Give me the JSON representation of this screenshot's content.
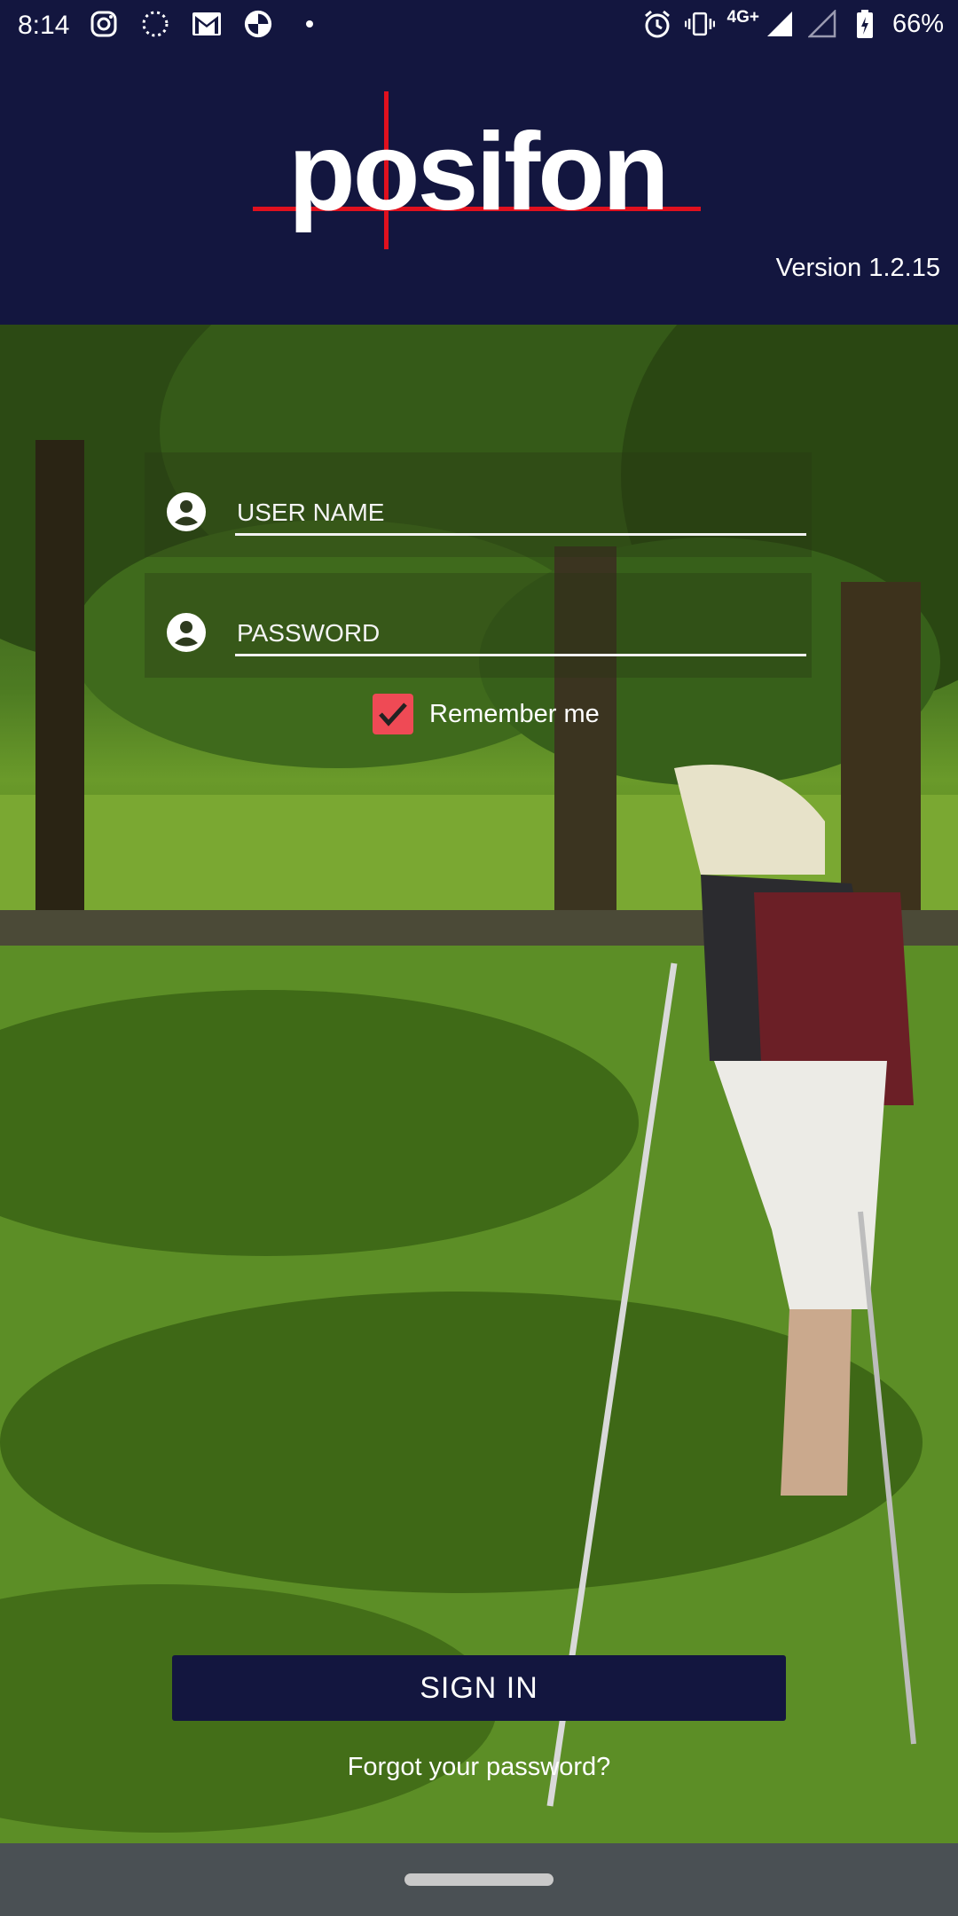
{
  "status_bar": {
    "time": "8:14",
    "network": "4G+",
    "battery": "66%",
    "left_icons": [
      "instagram-icon",
      "loading-dots-icon",
      "gmail-icon",
      "shutter-icon",
      "dot-icon"
    ],
    "right_icons": [
      "alarm-icon",
      "vibrate-icon",
      "signal-icon",
      "signal-empty-icon",
      "battery-charging-icon"
    ]
  },
  "header": {
    "logo_text": "posifon",
    "version": "Version 1.2.15"
  },
  "login": {
    "username_placeholder": "USER NAME",
    "password_placeholder": "PASSWORD",
    "remember_label": "Remember me",
    "remember_checked": true,
    "signin_label": "SIGN IN",
    "forgot_label": "Forgot your password?"
  },
  "colors": {
    "brand_navy": "#13163f",
    "accent_red": "#e0101e",
    "checkbox": "#ef4a55"
  }
}
